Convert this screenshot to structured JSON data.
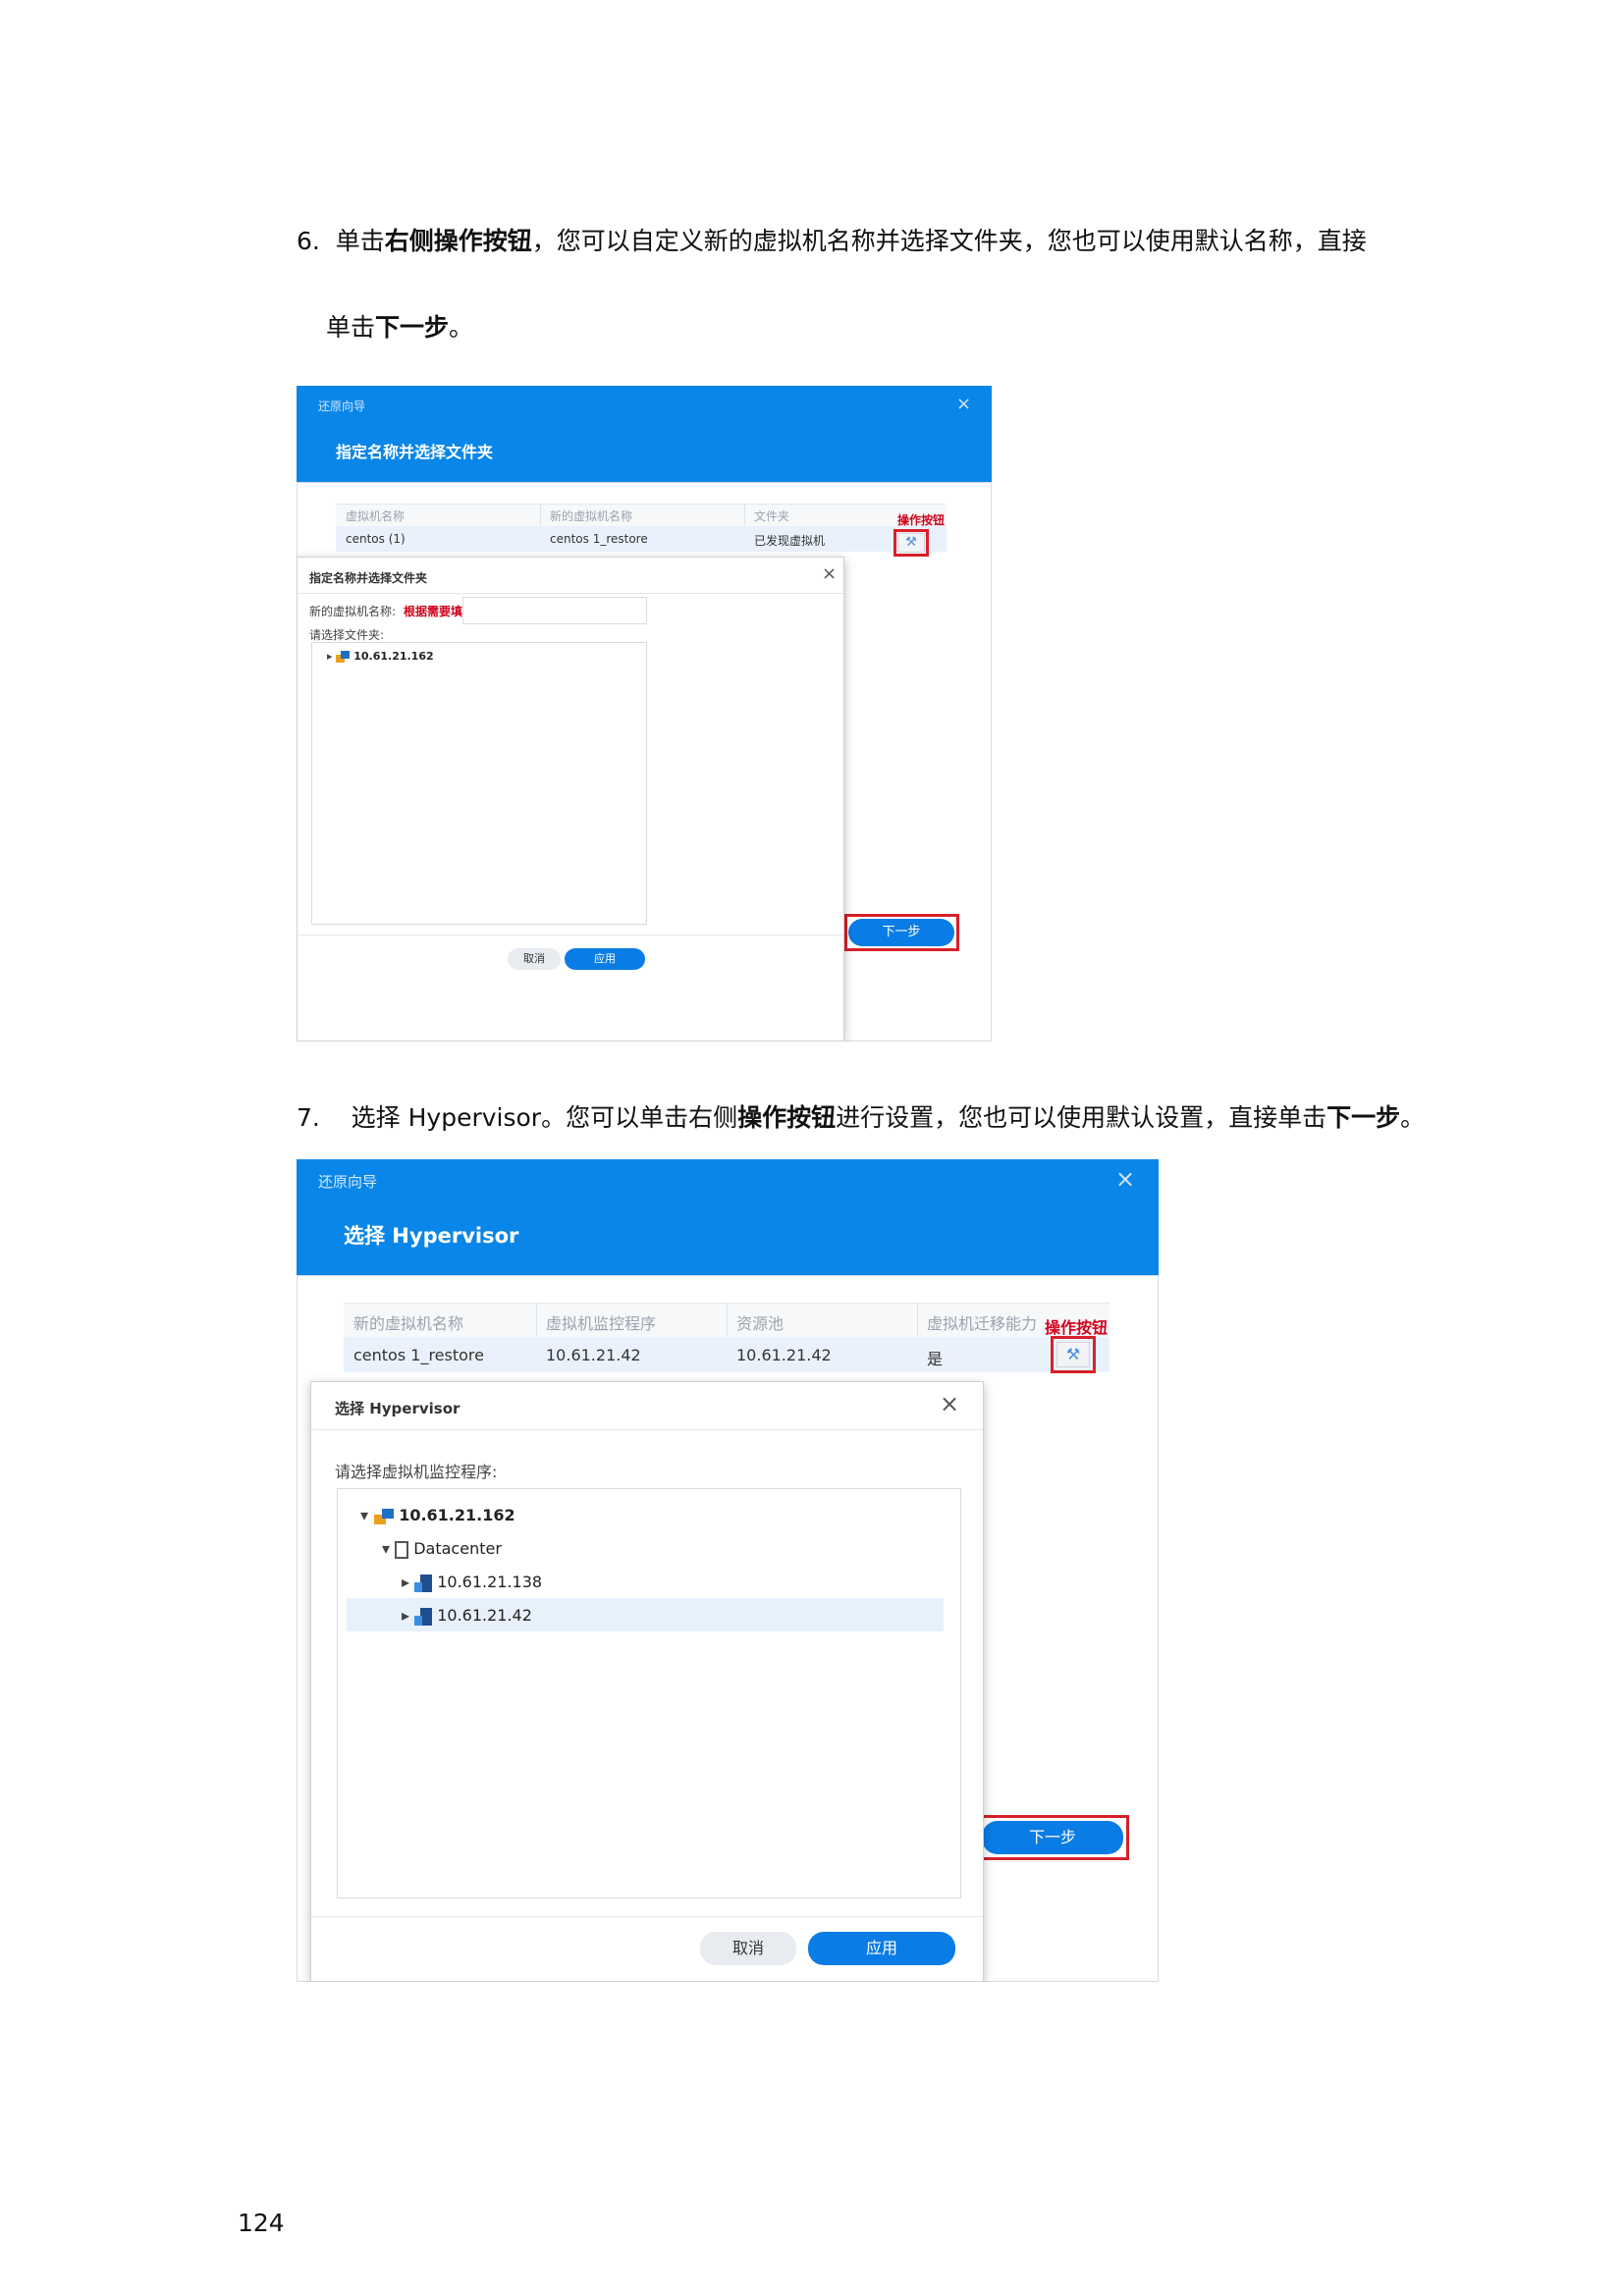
{
  "steps": [
    {
      "num": "6.",
      "line1_pre": "单击",
      "line1_bold": "右侧操作按钮",
      "line1_post": "，您可以自定义新的虚拟机名称并选择文件夹，您也可以使用默认名称，直接",
      "line2_pre": "单击",
      "line2_bold": "下一步",
      "line2_post": "。"
    },
    {
      "num": "7.",
      "text_pre": "选择 Hypervisor。您可以单击右侧",
      "text_bold1": "操作按钮",
      "text_mid": "进行设置，您也可以使用默认设置，直接单击",
      "text_bold2": "下一步",
      "text_post": "。"
    }
  ],
  "shot1": {
    "crumb": "还原向导",
    "title": "指定名称并选择文件夹",
    "close_icon": "×",
    "columns": [
      "虚拟机名称",
      "新的虚拟机名称",
      "文件夹"
    ],
    "row": [
      "centos (1)",
      "centos 1_restore",
      "已发现虚拟机"
    ],
    "annot_action": "操作按钮",
    "next_button": "下一步",
    "dialog": {
      "title": "指定名称并选择文件夹",
      "close_icon": "×",
      "name_label": "新的虚拟机名称:",
      "name_annot": "根据需要填写",
      "folder_label": "请选择文件夹:",
      "tree": [
        {
          "label": "10.61.21.162"
        }
      ],
      "cancel": "取消",
      "apply": "应用"
    }
  },
  "shot2": {
    "crumb": "还原向导",
    "title": "选择 Hypervisor",
    "close_icon": "×",
    "columns": [
      "新的虚拟机名称",
      "虚拟机监控程序",
      "资源池",
      "虚拟机迁移能力"
    ],
    "row": [
      "centos 1_restore",
      "10.61.21.42",
      "10.61.21.42",
      "是"
    ],
    "annot_action": "操作按钮",
    "next_button": "下一步",
    "dialog": {
      "title": "选择 Hypervisor",
      "close_icon": "×",
      "label": "请选择虚拟机监控程序:",
      "tree": [
        {
          "label": "10.61.21.162"
        },
        {
          "label": "Datacenter"
        },
        {
          "label": "10.61.21.138"
        },
        {
          "label": "10.61.21.42"
        }
      ],
      "cancel": "取消",
      "apply": "应用"
    }
  },
  "page_number": "124"
}
